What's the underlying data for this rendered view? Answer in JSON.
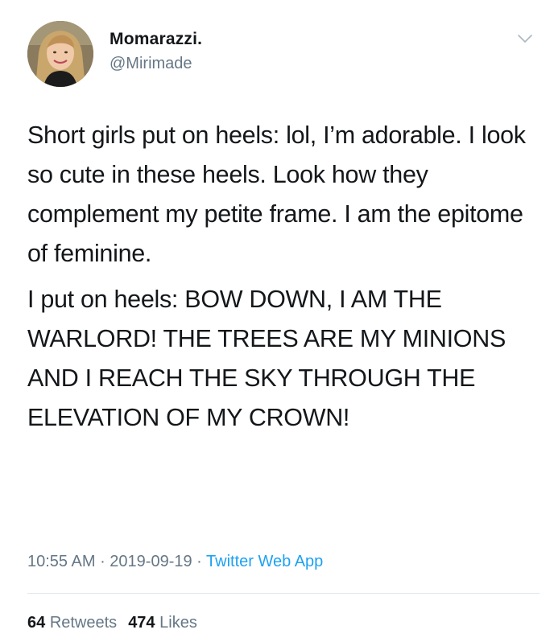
{
  "user": {
    "display_name": "Momarazzi.",
    "handle": "@Mirimade"
  },
  "tweet": {
    "paragraphs": [
      "Short girls put on heels: lol, I’m adorable. I look so cute in these heels. Look how they complement my petite frame. I am the epitome of feminine.",
      "I put on heels: BOW DOWN, I AM THE WARLORD! THE TREES ARE MY MINIONS AND I REACH THE SKY THROUGH THE ELEVATION OF MY CROWN!"
    ],
    "time": "10:55 AM",
    "date": "2019-09-19",
    "separator": " · ",
    "source": "Twitter Web App"
  },
  "stats": {
    "retweets_count": "64",
    "retweets_label": "Retweets",
    "likes_count": "474",
    "likes_label": "Likes"
  },
  "icons": {
    "menu": "chevron-down-icon"
  },
  "colors": {
    "text": "#14171a",
    "secondary": "#657786",
    "link": "#1da1f2",
    "divider": "#e1e8ed"
  }
}
